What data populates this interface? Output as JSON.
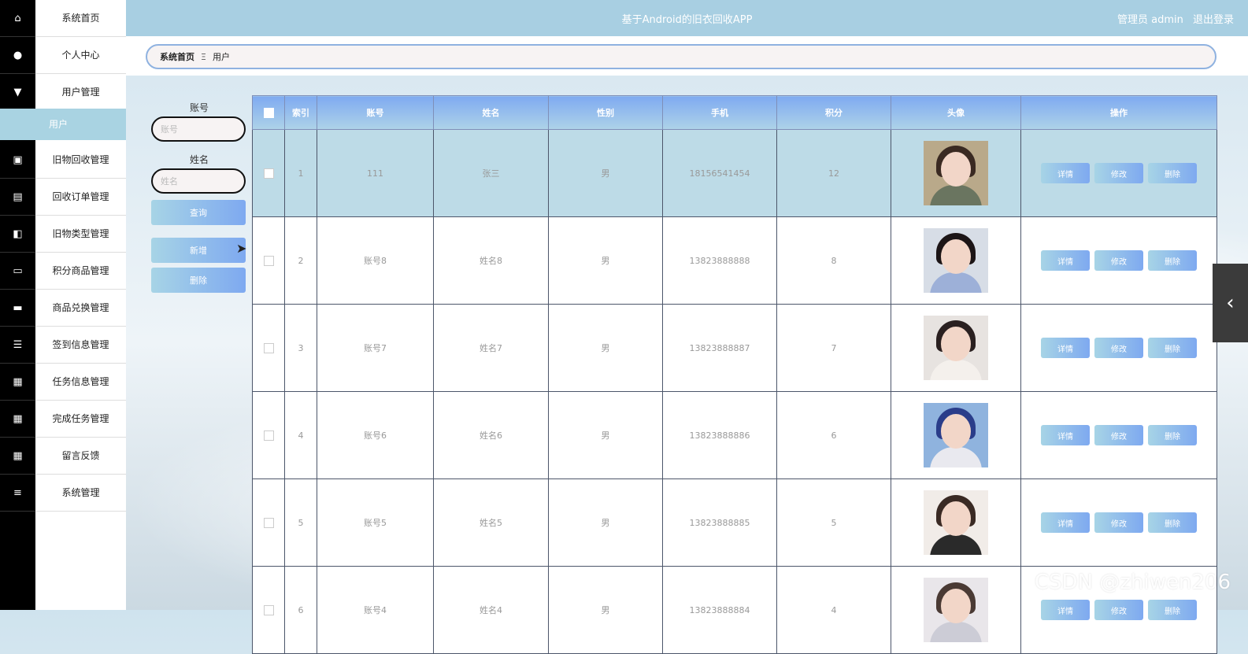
{
  "header": {
    "app_title": "基于Android的旧衣回收APP",
    "admin_label": "管理员 admin",
    "logout_label": "退出登录"
  },
  "sidebar": {
    "items": [
      {
        "label": "系统首页",
        "icon": "home-icon",
        "glyph": "⌂"
      },
      {
        "label": "个人中心",
        "icon": "user-icon",
        "glyph": "●"
      },
      {
        "label": "用户管理",
        "icon": "users-icon",
        "glyph": "▼"
      },
      {
        "label": "旧物回收管理",
        "icon": "clipboard-icon",
        "glyph": "▣"
      },
      {
        "label": "回收订单管理",
        "icon": "message-icon",
        "glyph": "▤"
      },
      {
        "label": "旧物类型管理",
        "icon": "wallet-icon",
        "glyph": "◧"
      },
      {
        "label": "积分商品管理",
        "icon": "monitor-icon",
        "glyph": "▭"
      },
      {
        "label": "商品兑换管理",
        "icon": "printer-icon",
        "glyph": "▬"
      },
      {
        "label": "签到信息管理",
        "icon": "sliders-icon",
        "glyph": "☰"
      },
      {
        "label": "任务信息管理",
        "icon": "grid-icon",
        "glyph": "▦"
      },
      {
        "label": "完成任务管理",
        "icon": "grid-icon",
        "glyph": "▦"
      },
      {
        "label": "留言反馈",
        "icon": "grid-icon",
        "glyph": "▦"
      },
      {
        "label": "系统管理",
        "icon": "list-icon",
        "glyph": "≡"
      }
    ],
    "active_sub": "用户"
  },
  "breadcrumb": {
    "home": "系统首页",
    "separator": "Ξ",
    "current": "用户"
  },
  "search": {
    "account_label": "账号",
    "account_placeholder": "账号",
    "name_label": "姓名",
    "name_placeholder": "姓名",
    "query_button": "查询",
    "add_button": "新增",
    "delete_button": "删除"
  },
  "table": {
    "columns": [
      "索引",
      "账号",
      "姓名",
      "性别",
      "手机",
      "积分",
      "头像",
      "操作"
    ],
    "rows": [
      {
        "index": "1",
        "account": "111",
        "name": "张三",
        "gender": "男",
        "phone": "18156541454",
        "points": "12"
      },
      {
        "index": "2",
        "account": "账号8",
        "name": "姓名8",
        "gender": "男",
        "phone": "13823888888",
        "points": "8"
      },
      {
        "index": "3",
        "account": "账号7",
        "name": "姓名7",
        "gender": "男",
        "phone": "13823888887",
        "points": "7"
      },
      {
        "index": "4",
        "account": "账号6",
        "name": "姓名6",
        "gender": "男",
        "phone": "13823888886",
        "points": "6"
      },
      {
        "index": "5",
        "account": "账号5",
        "name": "姓名5",
        "gender": "男",
        "phone": "13823888885",
        "points": "5"
      },
      {
        "index": "6",
        "account": "账号4",
        "name": "姓名4",
        "gender": "男",
        "phone": "13823888884",
        "points": "4"
      }
    ],
    "actions": {
      "detail": "详情",
      "edit": "修改",
      "delete": "删除"
    }
  },
  "watermark": "CSDN @zhiwen206",
  "colors": {
    "topbar": "#a8cfe2",
    "button_gradient_start": "#a7d4e6",
    "button_gradient_end": "#7ea9f0",
    "sidebar_icons": "#000000",
    "highlight_row": "#bddbe7"
  }
}
